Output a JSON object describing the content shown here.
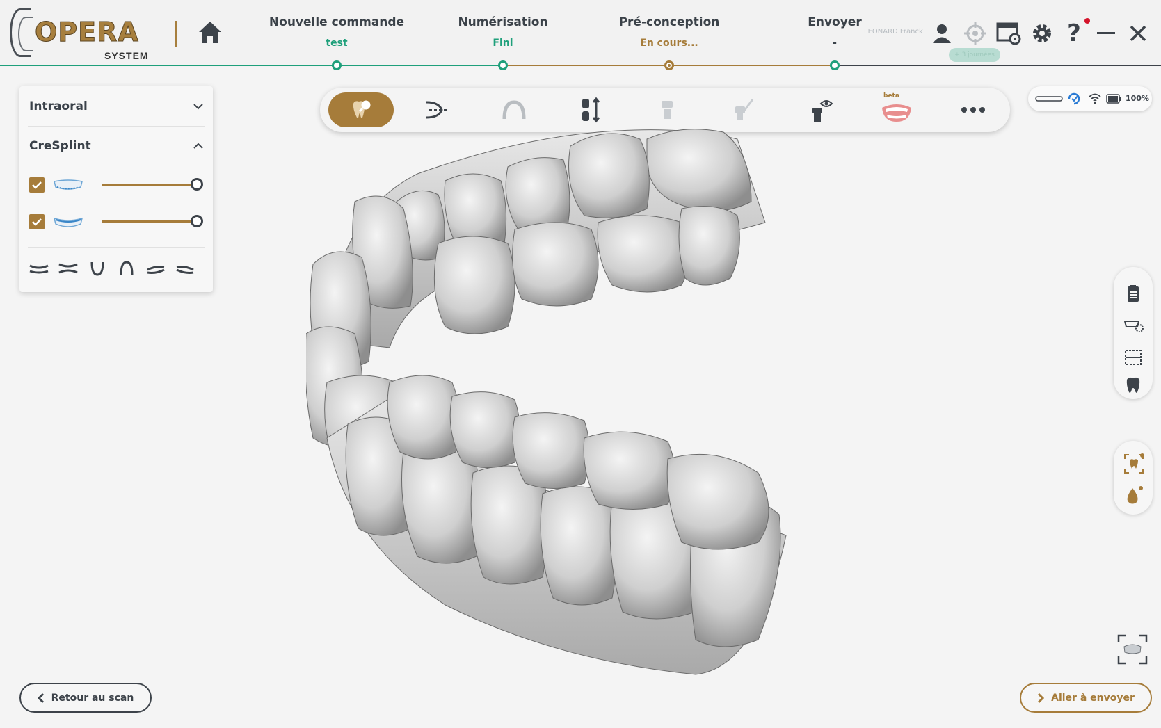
{
  "app": {
    "logo_text": "OPERA",
    "logo_sub": "SYSTEM",
    "user_name": "LEONARD Franck",
    "license_badge": "+ 3 journées"
  },
  "steps": [
    {
      "title": "Nouvelle commande",
      "status": "test",
      "color": "#1fa07b"
    },
    {
      "title": "Numérisation",
      "status": "Fini",
      "color": "#1fa07b"
    },
    {
      "title": "Pré-conception",
      "status": "En cours...",
      "color": "#a67c3a"
    },
    {
      "title": "Envoyer",
      "status": "-",
      "color": "#3b4249"
    }
  ],
  "header_icons": [
    "user-icon",
    "target-icon",
    "window-settings-icon",
    "gear-icon",
    "help-icon",
    "minimize-icon",
    "close-icon"
  ],
  "left_panel": {
    "section1": "Intraoral",
    "section2": "CreSplint",
    "layers": [
      {
        "name": "upper-splint",
        "checked": true,
        "opacity": 1.0
      },
      {
        "name": "lower-splint",
        "checked": true,
        "opacity": 1.0
      }
    ],
    "view_buttons": [
      "view-upper-icon",
      "view-both-icon",
      "view-lower-arch-icon",
      "view-upper-arch-icon",
      "view-left-icon",
      "view-right-icon"
    ]
  },
  "toolbar": {
    "tools": [
      "tooth-inspect-icon",
      "insertion-axis-icon",
      "arch-icon",
      "tooth-move-icon",
      "implant-icon",
      "sculpt-icon",
      "preview-icon",
      "smile-design-icon",
      "more-icon"
    ],
    "beta_label": "beta",
    "active_index": 0
  },
  "status": {
    "battery": "100%",
    "icons": [
      "scanner-icon",
      "sync-icon",
      "wifi-icon",
      "battery-icon"
    ]
  },
  "right_tools": {
    "group1": [
      "clipboard-icon",
      "teeth-gear-icon",
      "teeth-grid-icon",
      "tooth-icon"
    ],
    "group2": [
      "focus-tooth-icon",
      "drop-icon"
    ]
  },
  "buttons": {
    "back": "Retour au scan",
    "next": "Aller à envoyer"
  },
  "colors": {
    "accent": "#a67c3a",
    "done": "#1fa07b",
    "text": "#3a4149"
  }
}
